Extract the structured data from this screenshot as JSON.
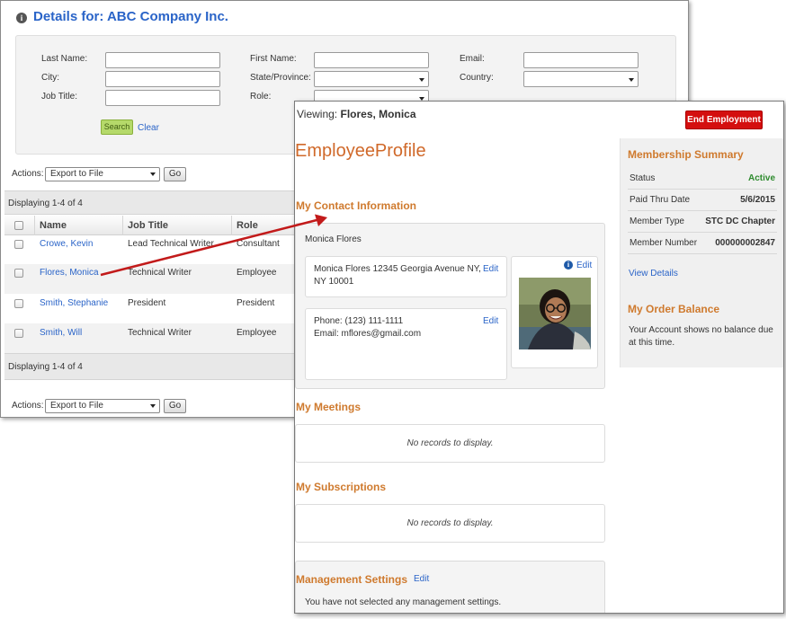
{
  "company_window": {
    "title": "Details for: ABC Company Inc.",
    "search": {
      "last_name_label": "Last Name:",
      "first_name_label": "First Name:",
      "email_label": "Email:",
      "city_label": "City:",
      "state_label": "State/Province:",
      "country_label": "Country:",
      "job_title_label": "Job Title:",
      "role_label": "Role:",
      "search_button": "Search",
      "clear_link": "Clear"
    },
    "actions_label": "Actions:",
    "actions_select": "Export to File",
    "go_button": "Go",
    "displaying": "Displaying 1-4 of 4",
    "columns": [
      "Name",
      "Job Title",
      "Role"
    ],
    "rows": [
      {
        "name": "Crowe, Kevin",
        "job_title": "Lead Technical Writer",
        "role": "Consultant"
      },
      {
        "name": "Flores, Monica",
        "job_title": "Technical Writer",
        "role": "Employee"
      },
      {
        "name": "Smith, Stephanie",
        "job_title": "President",
        "role": "President"
      },
      {
        "name": "Smith, Will",
        "job_title": "Technical Writer",
        "role": "Employee"
      }
    ]
  },
  "profile_window": {
    "viewing_label": "Viewing:",
    "viewing_name": "Flores, Monica",
    "end_button": "End Employment",
    "page_title": "EmployeeProfile",
    "contact": {
      "title": "My Contact Information",
      "name": "Monica Flores",
      "address_line1": "Monica Flores 12345 Georgia Avenue NY,",
      "address_line2": "NY 10001",
      "phone": "Phone: (123) 111-1111",
      "email": "Email: mflores@gmail.com",
      "edit_label": "Edit"
    },
    "meetings": {
      "title": "My Meetings",
      "empty": "No records to display."
    },
    "subscriptions": {
      "title": "My Subscriptions",
      "empty": "No records to display."
    },
    "management": {
      "title": "Management Settings",
      "edit_label": "Edit",
      "text": "You have not selected any management settings."
    },
    "membership": {
      "title": "Membership Summary",
      "rows": [
        {
          "label": "Status",
          "value": "Active"
        },
        {
          "label": "Paid Thru Date",
          "value": "5/6/2015"
        },
        {
          "label": "Member Type",
          "value": "STC DC Chapter"
        },
        {
          "label": "Member Number",
          "value": "000000002847"
        }
      ],
      "view_details": "View Details"
    },
    "order_balance": {
      "title": "My Order Balance",
      "line1": "Your Account shows no balance due",
      "line2": "at this time."
    }
  },
  "colors": {
    "link": "#2a64c8",
    "section_title": "#cf7a2e",
    "end_button": "#d40f0f",
    "active_status": "#2e8b2e",
    "search_button": "#b5d96a",
    "arrow": "#c21a1a"
  }
}
